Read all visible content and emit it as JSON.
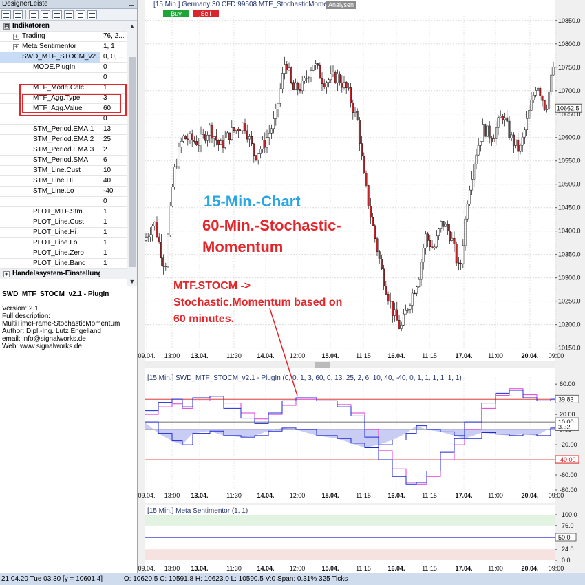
{
  "sidebar": {
    "title": "DesignerLeiste",
    "rows": [
      {
        "label": "Indikatoren",
        "value": "",
        "type": "cat",
        "expander": "⊟"
      },
      {
        "label": "Trading",
        "value": "76, 2...",
        "type": "lvl1",
        "expander": "+"
      },
      {
        "label": "Meta Sentimentor",
        "value": "1, 1",
        "type": "lvl1",
        "expander": "+"
      },
      {
        "label": "SWD_MTF_STOCM_v2...",
        "value": "0, 0, ...",
        "type": "lvl1 sel",
        "expander": "−"
      },
      {
        "label": "MODE.PlugIn",
        "value": "0",
        "type": "prop"
      },
      {
        "label": "",
        "value": "0",
        "type": "prop"
      },
      {
        "label": "MTF_Mode.Calc",
        "value": "1",
        "type": "prop"
      },
      {
        "label": "MTF_Agg.Type",
        "value": "3",
        "type": "prop"
      },
      {
        "label": "MTF_Agg.Value",
        "value": "60",
        "type": "prop"
      },
      {
        "label": "",
        "value": "0",
        "type": "prop"
      },
      {
        "label": "STM_Period.EMA.1",
        "value": "13",
        "type": "prop"
      },
      {
        "label": "STM_Period.EMA.2",
        "value": "25",
        "type": "prop"
      },
      {
        "label": "STM_Period.EMA.3",
        "value": "2",
        "type": "prop"
      },
      {
        "label": "STM_Period.SMA",
        "value": "6",
        "type": "prop"
      },
      {
        "label": "STM_Line.Cust",
        "value": "10",
        "type": "prop"
      },
      {
        "label": "STM_Line.Hi",
        "value": "40",
        "type": "prop"
      },
      {
        "label": "STM_Line.Lo",
        "value": "-40",
        "type": "prop"
      },
      {
        "label": "",
        "value": "0",
        "type": "prop"
      },
      {
        "label": "PLOT_MTF.Stm",
        "value": "1",
        "type": "prop"
      },
      {
        "label": "PLOT_Line.Cust",
        "value": "1",
        "type": "prop"
      },
      {
        "label": "PLOT_Line.Hi",
        "value": "1",
        "type": "prop"
      },
      {
        "label": "PLOT_Line.Lo",
        "value": "1",
        "type": "prop"
      },
      {
        "label": "PLOT_Line.Zero",
        "value": "1",
        "type": "prop"
      },
      {
        "label": "PLOT_Line.Band",
        "value": "1",
        "type": "prop"
      }
    ],
    "category_bottom": {
      "label": "Handelssystem-Einstellungen",
      "expander": "+"
    }
  },
  "description": {
    "title": "SWD_MTF_STOCM_v2.1 - PlugIn",
    "lines": [
      "Version: 2.1",
      "Full description:",
      "MultiTimeFrame-StochasticMomentum",
      "Author: Dipl.-Ing. Lutz Engelland",
      "email: info@signalworks.de",
      "Web: www.signalworks.de"
    ]
  },
  "price_chart": {
    "header": "[15 Min.] Germany 30 CFD   99508 MTF_StochasticMomentum",
    "analysen": "Analysen",
    "buy": "Buy",
    "sell": "Sell",
    "current_price": "10662.5",
    "ylabels": [
      "10850.0",
      "10800.0",
      "10750.0",
      "10700.0",
      "10650.0",
      "10600.0",
      "10550.0",
      "10500.0",
      "10450.0",
      "10400.0",
      "10350.0",
      "10300.0",
      "10250.0",
      "10200.0",
      "10150.0"
    ],
    "xlabels": [
      "09.04.",
      "13:00",
      "13.04.",
      "11:30",
      "14.04.",
      "12:00",
      "15.04.",
      "11:15",
      "16.04.",
      "11:15",
      "17.04.",
      "11:00",
      "20.04.",
      "09:00"
    ],
    "bold_xlabels": [
      "13.04.",
      "14.04.",
      "15.04.",
      "16.04.",
      "17.04.",
      "20.04."
    ],
    "annotation_blue": "15-Min.-Chart",
    "annotation_red_1": "60-Min.-Stochastic-",
    "annotation_red_2": "Momentum",
    "annotation_mtf_1": "MTF.STOCM ->",
    "annotation_mtf_2": "Stochastic.Momentum based on",
    "annotation_mtf_3": "60 minutes."
  },
  "osc_chart": {
    "header": "[15 Min.] SWD_MTF_STOCM_v2.1 - PlugIn  (0, 0, 1, 3, 60, 0, 13, 25, 2, 6, 10, 40, -40, 0, 1, 1, 1, 1, 1, 1)",
    "ylabels": [
      "60.00",
      "40.00",
      "20.00",
      "0.00",
      "-20.00",
      "-40.00",
      "-60.00",
      "-80.00"
    ],
    "badges": [
      "39.83",
      "10.00",
      "3.32",
      "-40.00"
    ]
  },
  "sentiment_chart": {
    "header": "[15 Min.] Meta Sentimentor  (1, 1)",
    "ylabels": [
      "100.0",
      "76.0",
      "50.0",
      "24.0",
      "0.0"
    ],
    "badge": "50.0"
  },
  "status": {
    "datetime": "21.04.20 Tue  03:30 [y = 10601.4]",
    "ohlc": "O: 10620.5 C: 10591.8 H: 10623.0 L: 10590.5 V:0 Span: 0.31% 325 Ticks"
  },
  "colors": {
    "candle_up": "#c0262c",
    "stoch_blue": "#1c28d8",
    "stoch_magenta": "#e23cd8",
    "band_fill": "#c9ccf3",
    "hi_lo_line": "#d81c1c",
    "sent_green": "#e2f3e2",
    "sent_red": "#f7e2e2",
    "annotation_blue": "#2aa6e6",
    "annotation_red": "#e3262a"
  }
}
